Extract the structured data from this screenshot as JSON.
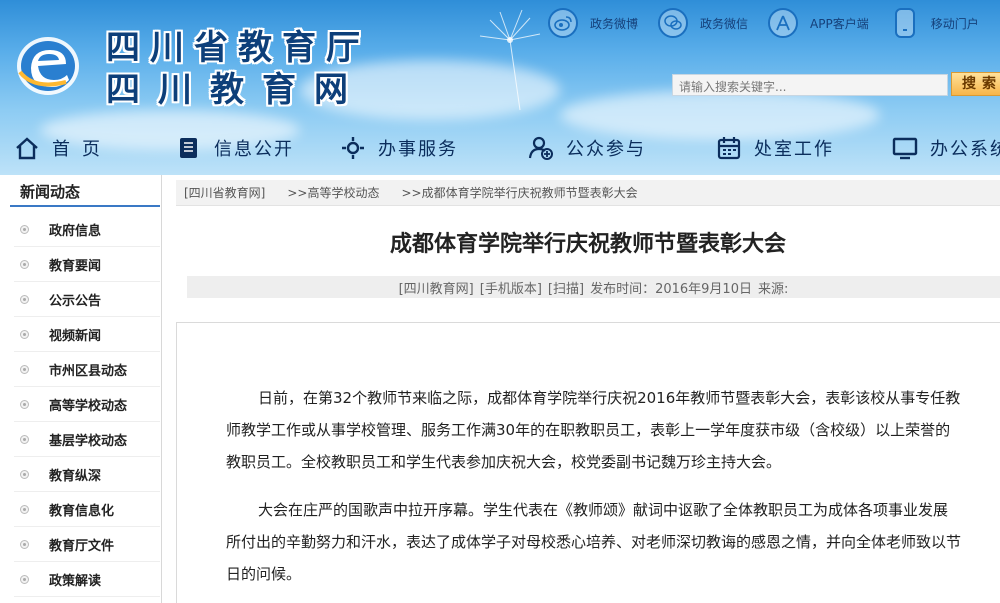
{
  "header": {
    "title_line1": "四川省教育厅",
    "title_line2": "四川教育网",
    "top_links": [
      {
        "label": "政务微博",
        "icon": "weibo-icon"
      },
      {
        "label": "政务微信",
        "icon": "wechat-icon"
      },
      {
        "label": "APP客户端",
        "icon": "app-store-icon"
      },
      {
        "label": "移动门户",
        "icon": "mobile-phone-icon"
      }
    ],
    "search": {
      "placeholder": "请输入搜索关键字...",
      "button": "搜索"
    },
    "colors": {
      "brand": "#1a6fbf",
      "title": "#0d3f7a"
    }
  },
  "nav": [
    {
      "label": "首页",
      "icon": "home-icon"
    },
    {
      "label": "信息公开",
      "icon": "document-list-icon"
    },
    {
      "label": "办事服务",
      "icon": "service-gear-icon"
    },
    {
      "label": "公众参与",
      "icon": "user-plus-icon"
    },
    {
      "label": "处室工作",
      "icon": "calendar-icon"
    },
    {
      "label": "办公系统",
      "icon": "monitor-icon"
    }
  ],
  "sidebar": {
    "heading": "新闻动态",
    "items": [
      {
        "label": "政府信息"
      },
      {
        "label": "教育要闻"
      },
      {
        "label": "公示公告"
      },
      {
        "label": "视频新闻"
      },
      {
        "label": "市州区县动态"
      },
      {
        "label": "高等学校动态"
      },
      {
        "label": "基层学校动态"
      },
      {
        "label": "教育纵深"
      },
      {
        "label": "教育信息化"
      },
      {
        "label": "教育厅文件"
      },
      {
        "label": "政策解读"
      }
    ]
  },
  "breadcrumb": [
    "[四川省教育网]",
    ">>高等学校动态",
    ">>成都体育学院举行庆祝教师节暨表彰大会"
  ],
  "article": {
    "title": "成都体育学院举行庆祝教师节暨表彰大会",
    "meta": {
      "source": "[四川教育网]",
      "mobile": "[手机版本]",
      "scan": "[扫描]",
      "publish": "发布时间：2016年9月10日",
      "origin": "来源:"
    },
    "paragraphs": [
      "日前，在第32个教师节来临之际，成都体育学院举行庆祝2016年教师节暨表彰大会，表彰该校从事专任教师教学工作或从事学校管理、服务工作满30年的在职教职员工，表彰上一学年度获市级（含校级）以上荣誉的教职员工。全校教职员工和学生代表参加庆祝大会，校党委副书记魏万珍主持大会。",
      "大会在庄严的国歌声中拉开序幕。学生代表在《教师颂》献词中讴歌了全体教职员工为成体各项事业发展所付出的辛勤努力和汗水，表达了成体学子对母校悉心培养、对老师深切教诲的感恩之情，并向全体老师致以节日的问候。"
    ]
  }
}
